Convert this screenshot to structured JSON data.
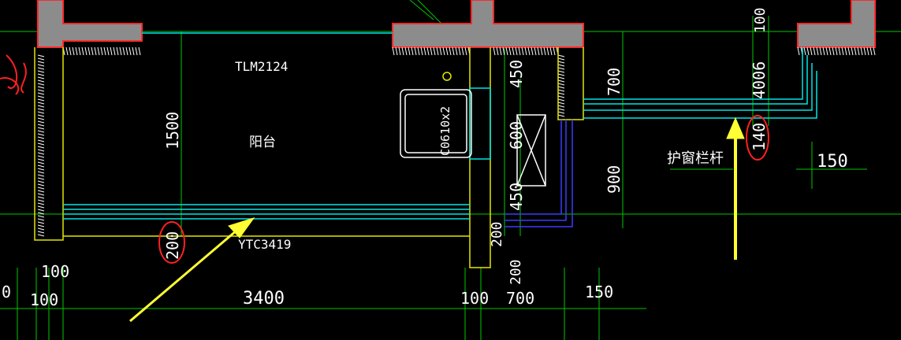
{
  "labels": {
    "door_tag": "TLM2124",
    "window_tag": "YTC3419",
    "balcony": "阳台",
    "rail_note": "护窗栏杆",
    "unit_tag": "C0610x2"
  },
  "dimensions": {
    "h_1500": "1500",
    "h_200_left": "200",
    "h_200_mid": "200",
    "h_200_low": "200",
    "v_450_top": "450",
    "v_600": "600",
    "v_450_bot": "450",
    "v_700": "700",
    "v_900": "900",
    "v_100_top": "100",
    "v_4006": "4006",
    "v_140": "140",
    "d_150_right": "150",
    "b_100_a": "100",
    "b_100_b": "100",
    "b_0": "0",
    "b_3400": "3400",
    "b_100_c": "100",
    "b_700": "700",
    "b_150": "150"
  },
  "colors": {
    "background": "#000000",
    "wall_fill": "#8c8c8c",
    "wall_outline": "#ff2a2a",
    "hatch": "#ffffff",
    "axis_lines": "#00c800",
    "cyan_lines": "#00e5e5",
    "yellow_lines": "#e6e600",
    "highlight_arrow": "#ffff33",
    "circle_mark": "#ff2020",
    "blue_lines": "#3c3cff"
  }
}
